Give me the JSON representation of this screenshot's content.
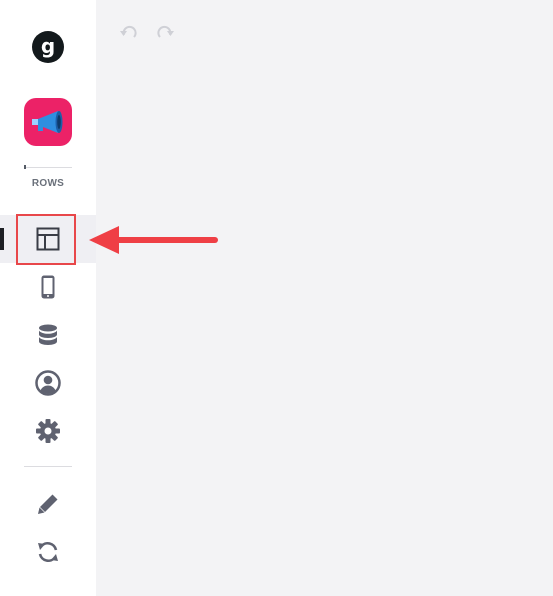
{
  "sidebar": {
    "logo_letter": "g",
    "section_label": "ROWS",
    "nav": [
      {
        "name": "layout",
        "icon": "layout-icon",
        "active": true
      },
      {
        "name": "mobile",
        "icon": "mobile-icon",
        "active": false
      },
      {
        "name": "database",
        "icon": "database-icon",
        "active": false
      },
      {
        "name": "users",
        "icon": "user-circle-icon",
        "active": false
      },
      {
        "name": "settings",
        "icon": "gear-icon",
        "active": false
      }
    ],
    "tools": [
      {
        "name": "edit",
        "icon": "pencil-icon"
      },
      {
        "name": "sync",
        "icon": "sync-icon"
      }
    ]
  },
  "toolbar": {
    "undo_icon": "undo-icon",
    "redo_icon": "redo-icon"
  },
  "colors": {
    "app_icon_bg": "#ec2267",
    "highlight": "#e8474a",
    "canvas_bg": "#f3f3f5",
    "icon": "#5f6270"
  }
}
